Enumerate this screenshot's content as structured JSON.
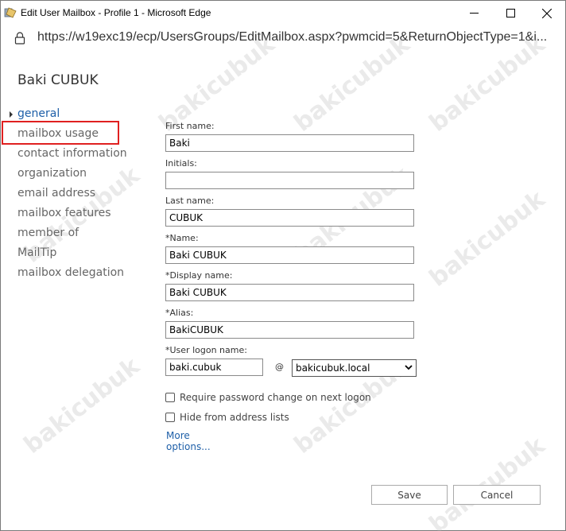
{
  "window": {
    "title": "Edit User Mailbox - Profile 1 - Microsoft Edge",
    "url": "https://w19exc19/ecp/UsersGroups/EditMailbox.aspx?pwmcid=5&ReturnObjectType=1&i..."
  },
  "page": {
    "user_title": "Baki CUBUK"
  },
  "nav": {
    "items": [
      {
        "label": "general",
        "active": true
      },
      {
        "label": "mailbox usage",
        "highlighted": true
      },
      {
        "label": "contact information"
      },
      {
        "label": "organization"
      },
      {
        "label": "email address"
      },
      {
        "label": "mailbox features"
      },
      {
        "label": "member of"
      },
      {
        "label": "MailTip"
      },
      {
        "label": "mailbox delegation"
      }
    ]
  },
  "form": {
    "first_name": {
      "label": "First name:",
      "value": "Baki"
    },
    "initials": {
      "label": "Initials:",
      "value": ""
    },
    "last_name": {
      "label": "Last name:",
      "value": "CUBUK"
    },
    "name": {
      "label": "*Name:",
      "value": "Baki CUBUK"
    },
    "display_name": {
      "label": "*Display name:",
      "value": "Baki CUBUK"
    },
    "alias": {
      "label": "*Alias:",
      "value": "BakiCUBUK"
    },
    "logon": {
      "label": "*User logon name:",
      "value": "baki.cubuk",
      "at": "@",
      "domain": "bakicubuk.local"
    },
    "require_pw_change": {
      "label": "Require password change on next logon",
      "checked": false
    },
    "hide_from_lists": {
      "label": "Hide from address lists",
      "checked": false
    },
    "more_options": "More options..."
  },
  "buttons": {
    "save": "Save",
    "cancel": "Cancel"
  },
  "watermark": "bakicubuk"
}
